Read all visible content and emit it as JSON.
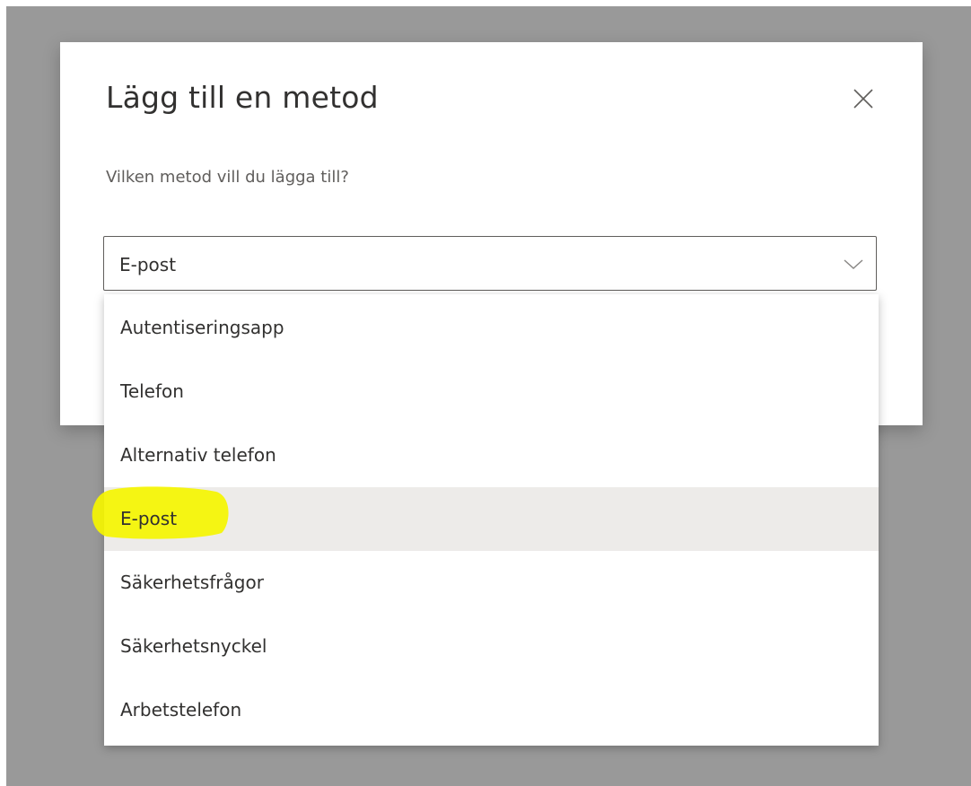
{
  "dialog": {
    "title": "Lägg till en metod",
    "question": "Vilken metod vill du lägga till?",
    "close_icon": "close-icon"
  },
  "select": {
    "value": "E-post",
    "chevron_icon": "chevron-down-icon"
  },
  "dropdown": {
    "options": [
      {
        "label": "Autentiseringsapp"
      },
      {
        "label": "Telefon"
      },
      {
        "label": "Alternativ telefon"
      },
      {
        "label": "E-post",
        "selected": true
      },
      {
        "label": "Säkerhetsfrågor"
      },
      {
        "label": "Säkerhetsnyckel"
      },
      {
        "label": "Arbetstelefon"
      }
    ]
  },
  "colors": {
    "overlay": "#999999",
    "selected_row": "#edebe9",
    "annotation_highlight": "#f5f500",
    "text_primary": "#323130",
    "text_secondary": "#605e5c"
  }
}
